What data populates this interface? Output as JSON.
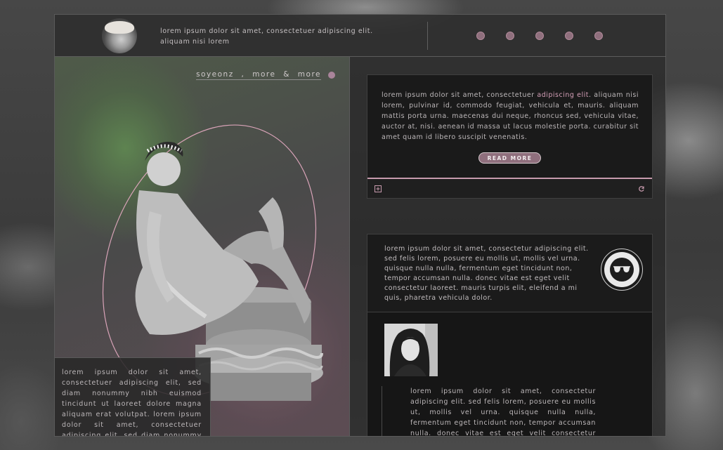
{
  "header": {
    "text": "lorem ipsum dolor sit amet, consectetuer adipiscing elit. aliquam nisi lorem",
    "nav_dots": 5
  },
  "left": {
    "credits": "soyeonz , more & more",
    "box_text": "lorem ipsum dolor sit amet, consectetuer adipiscing elit, sed diam nonummy nibh euismod tincidunt ut laoreet dolore magna aliquam erat volutpat. lorem ipsum dolor sit amet, consectetuer adipiscing elit, sed diam nonummy nibh euismod tincidunt ut laoreet dolore magna aliquam erat volutpat."
  },
  "card1": {
    "text_before": "lorem ipsum dolor sit amet, consectetuer ",
    "text_highlight": "adipiscing elit",
    "text_after": ". aliquam nisi lorem, pulvinar id, commodo feugiat, vehicula et, mauris. aliquam mattis porta urna. maecenas dui neque, rhoncus sed, vehicula vitae, auctor at, nisi. aenean id massa ut lacus molestie porta. curabitur sit amet quam id libero suscipit venenatis.",
    "read_more": "READ MORE",
    "icons": [
      "expand-icon",
      "refresh-icon"
    ]
  },
  "card2": {
    "top_text": "lorem ipsum dolor sit amet, consectetur adipiscing elit. sed felis lorem, posuere eu mollis ut, mollis vel urna. quisque nulla nulla, fermentum eget tincidunt non, tempor accumsan nulla. donec vitae est eget velit consectetur laoreet. mauris turpis elit, eleifend a mi quis, pharetra vehicula dolor.",
    "bottom_text": "lorem ipsum dolor sit amet, consectetur adipiscing elit. sed felis lorem, posuere eu mollis ut, mollis vel urna. quisque nulla nulla, fermentum eget tincidunt non, tempor accumsan nulla. donec vitae est eget velit consectetur laoreet. mauris turpis elit, eleifend a mi quis, pharetra vehicula dolor.",
    "emblem_icon": "sunglasses-icon"
  },
  "colors": {
    "accent": "#8f6f7d",
    "accent_light": "#c79aad",
    "highlight": "#d39eb6",
    "panel_dark": "#1a1a1a"
  }
}
